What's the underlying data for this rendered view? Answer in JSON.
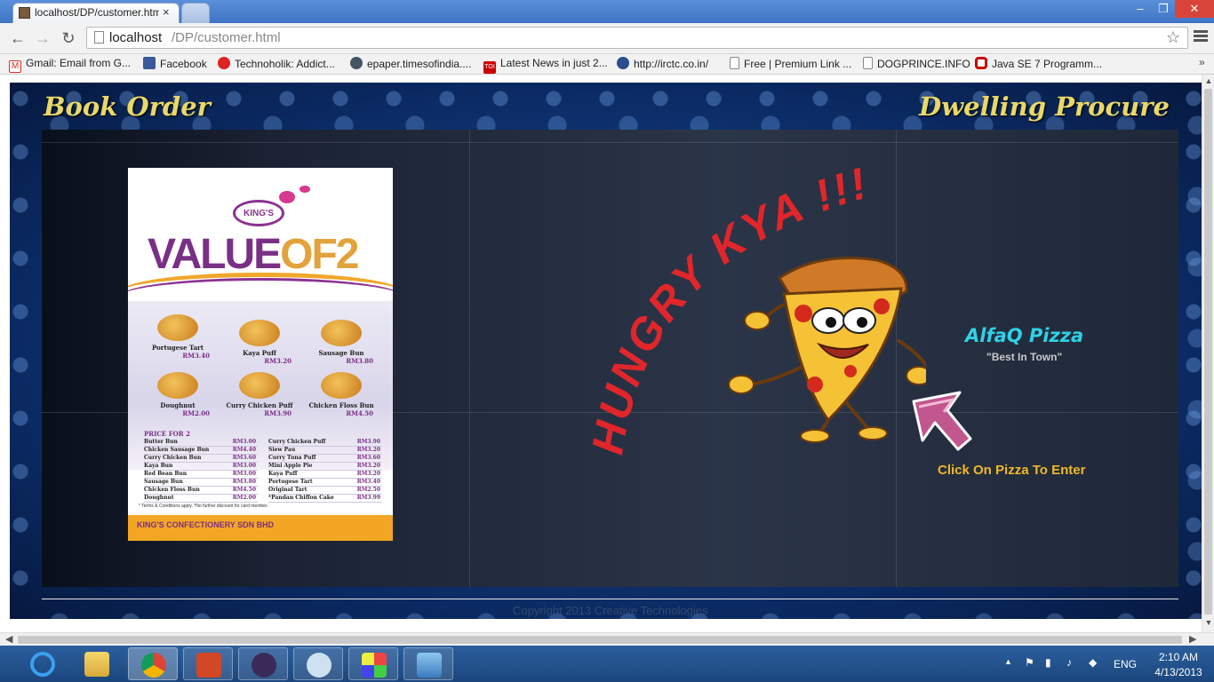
{
  "browser": {
    "tab_title": "localhost/DP/customer.html",
    "tab_close": "×",
    "url_host": "localhost",
    "url_path": "/DP/customer.html",
    "window_controls": {
      "minimize": "–",
      "maximize": "❐",
      "close": "✕"
    },
    "nav": {
      "back": "←",
      "forward": "→",
      "reload": "↻",
      "star": "☆"
    }
  },
  "bookmarks": [
    {
      "label": "Gmail: Email from G...",
      "icon_color": "#d93025"
    },
    {
      "label": "Facebook",
      "icon_color": "#3b5998"
    },
    {
      "label": "Technoholik: Addict...",
      "icon_color": "#d22"
    },
    {
      "label": "epaper.timesofindia....",
      "icon_color": "#456"
    },
    {
      "label": "Latest News in just 2...",
      "icon_color": "#c00"
    },
    {
      "label": "http://irctc.co.in/",
      "icon_color": "#2a4d8f"
    },
    {
      "label": "Free | Premium Link ...",
      "icon_color": "#fff"
    },
    {
      "label": "DOGPRINCE.INFO",
      "icon_color": "#fff"
    },
    {
      "label": "Java SE 7 Programm...",
      "icon_color": "#c00"
    }
  ],
  "bookmarks_more": "»",
  "site": {
    "title_left": "Book Order",
    "title_right": "Dwelling Procure",
    "hungry_text": "HUNGRY KYA !!!",
    "brand_name": "AlfaQ Pizza",
    "brand_tagline": "\"Best In  Town\"",
    "enter_hint": "Click On Pizza To Enter",
    "copyright": "Copyright 2013 Creative Technologies",
    "accent_color": "#e8d86a",
    "hungry_color": "#e0262a"
  },
  "flyer": {
    "logo": "KING'S",
    "headline_a": "VALUE",
    "headline_b": "OF2",
    "items": [
      {
        "name": "Portugese Tart",
        "price": "RM3.40"
      },
      {
        "name": "Kaya Puff",
        "price": "RM3.20"
      },
      {
        "name": "Sausage Bun",
        "price": "RM3.80"
      },
      {
        "name": "Doughnut",
        "price": "RM2.00"
      },
      {
        "name": "Curry Chicken Puff",
        "price": "RM3.90"
      },
      {
        "name": "Chicken Floss Bun",
        "price": "RM4.50"
      }
    ],
    "price_title": "PRICE FOR 2",
    "price_left": [
      {
        "name": "Butter Bun",
        "price": "RM3.00"
      },
      {
        "name": "Chicken Sausage Bun",
        "price": "RM4.40"
      },
      {
        "name": "Curry Chicken Bun",
        "price": "RM3.60"
      },
      {
        "name": "Kaya Bun",
        "price": "RM3.00"
      },
      {
        "name": "Red Bean Bun",
        "price": "RM3.00"
      },
      {
        "name": "Sausage Bun",
        "price": "RM3.80"
      },
      {
        "name": "Chicken Floss Bun",
        "price": "RM4.50"
      },
      {
        "name": "Doughnut",
        "price": "RM2.00"
      }
    ],
    "price_right": [
      {
        "name": "Curry Chicken Puff",
        "price": "RM3.90"
      },
      {
        "name": "Siew Pau",
        "price": "RM3.20"
      },
      {
        "name": "Curry Tuna Puff",
        "price": "RM3.60"
      },
      {
        "name": "Mini Apple Pie",
        "price": "RM3.20"
      },
      {
        "name": "Kaya Puff",
        "price": "RM3.20"
      },
      {
        "name": "Portugese Tart",
        "price": "RM3.40"
      },
      {
        "name": "Original Tart",
        "price": "RM2.50"
      },
      {
        "name": "*Pandan Chiffon Cake",
        "price": "RM3.99"
      }
    ],
    "terms": "* Terms & Conditions apply. *No further discount for card member.",
    "company": "KING'S CONFECTIONERY SDN BHD"
  },
  "scrollbars": {
    "up": "▲",
    "down": "▼",
    "left": "◀",
    "right": "▶"
  },
  "taskbar": {
    "apps": [
      "internet-explorer",
      "file-explorer",
      "chrome",
      "powerpoint",
      "java-ee-ide",
      "installer",
      "paint",
      "photos"
    ],
    "tray_arrow": "▲",
    "language": "ENG",
    "time": "2:10 AM",
    "date": "4/13/2013"
  }
}
